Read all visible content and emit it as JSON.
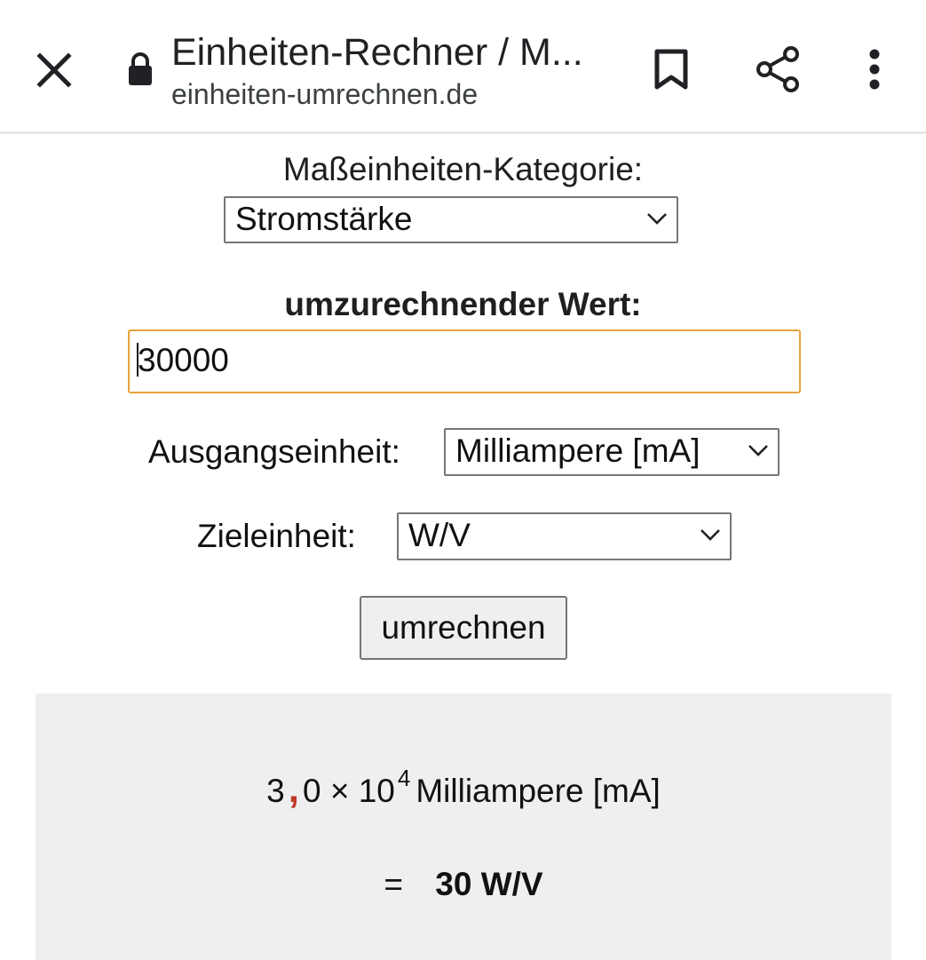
{
  "browser": {
    "page_title": "Einheiten-Rechner / M...",
    "url": "einheiten-umrechnen.de",
    "icons": {
      "close": "close-icon",
      "lock": "lock-icon",
      "bookmark": "bookmark-icon",
      "share": "share-icon",
      "menu": "more-vert-icon"
    }
  },
  "form": {
    "category_label": "Maßeinheiten-Kategorie:",
    "category_value": "Stromstärke",
    "value_label": "umzurechnender Wert:",
    "value_input": "30000",
    "source_label": "Ausgangseinheit:",
    "source_value": "Milliampere [mA]",
    "target_label": "Zieleinheit:",
    "target_value": "W/V",
    "convert_button": "umrechnen"
  },
  "result": {
    "mantissa_int": "3",
    "comma": ",",
    "mantissa_frac": "0",
    "times": "×",
    "base": "10",
    "exponent": "4",
    "source_unit": "Milliampere [mA]",
    "equals": "=",
    "converted": "30 W/V"
  },
  "colors": {
    "input_focus_border": "#e8a23a",
    "comma_accent": "#c0392b",
    "result_background": "#efefef"
  }
}
